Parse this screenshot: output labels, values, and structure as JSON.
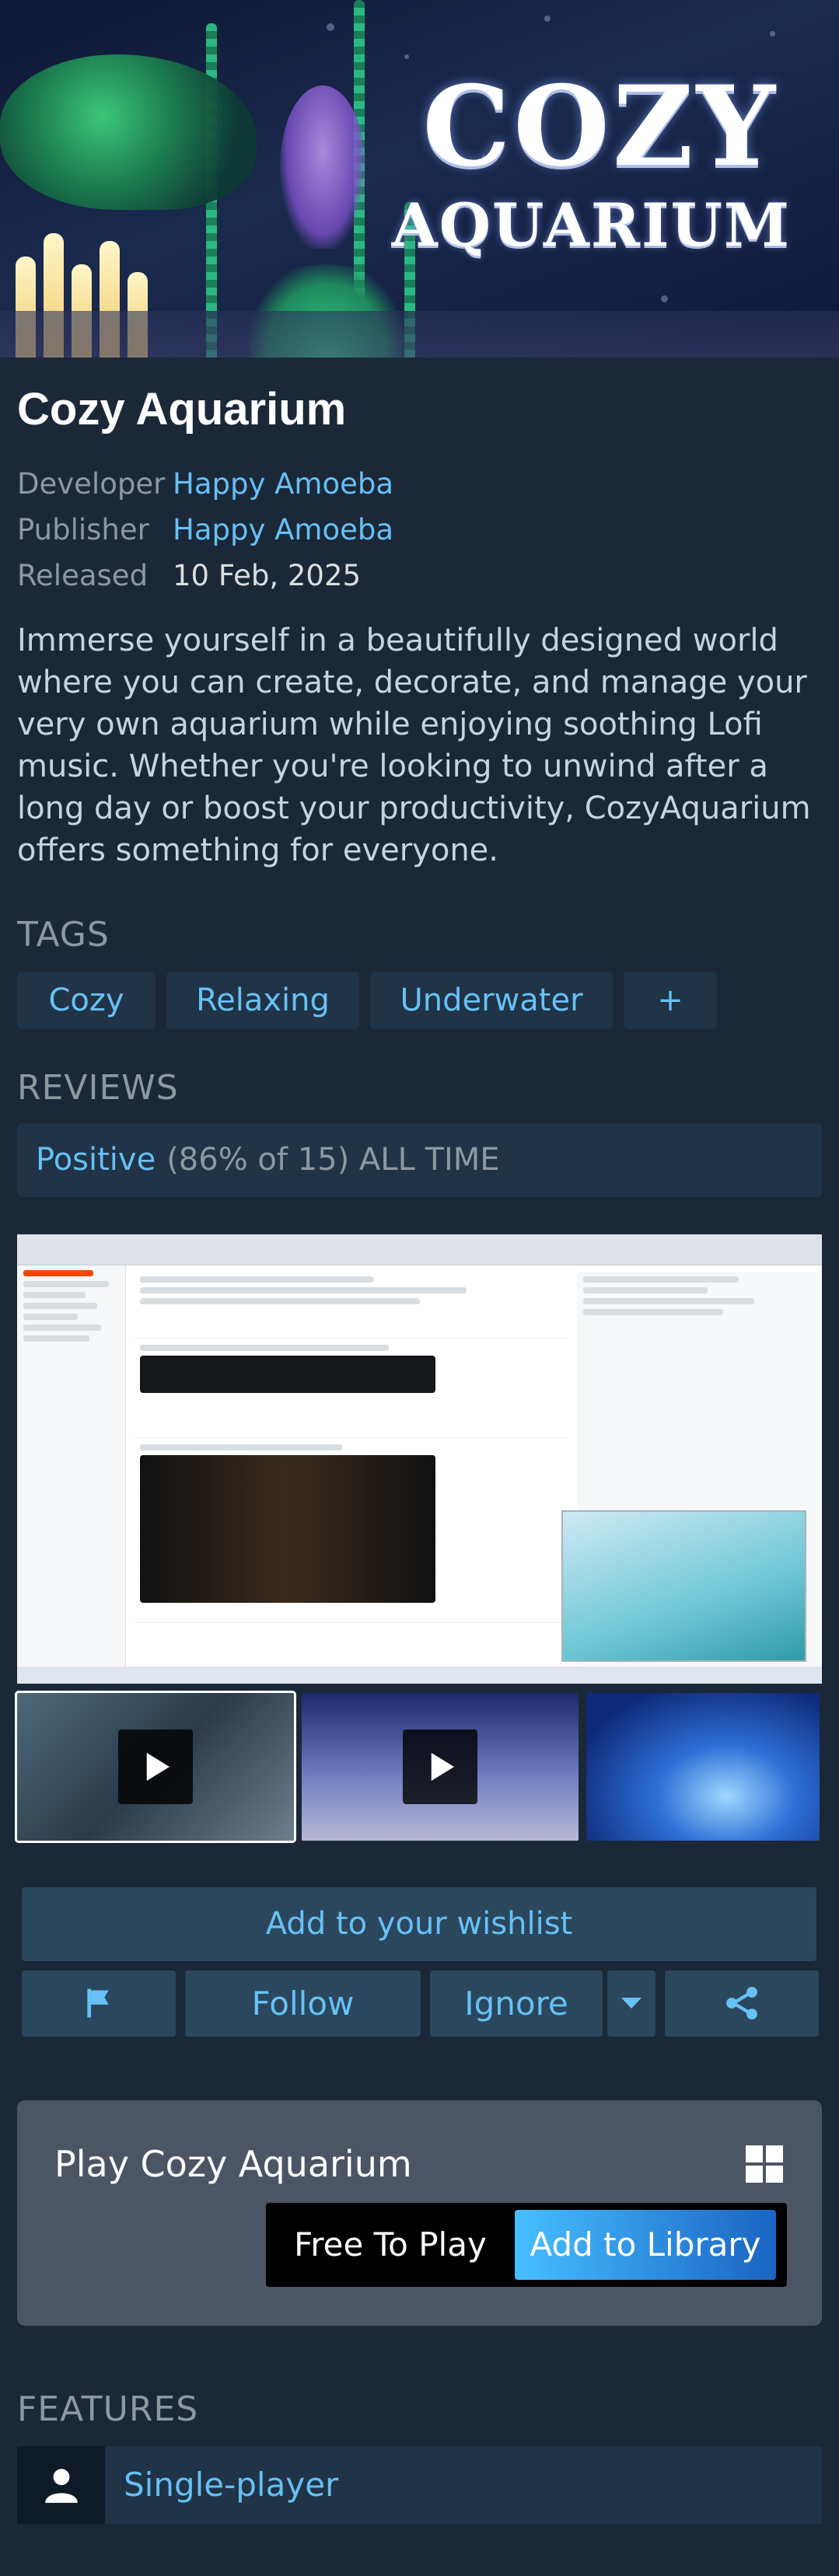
{
  "header": {
    "logo_line1": "COZY",
    "logo_line2": "AQUARIUM"
  },
  "game": {
    "title": "Cozy Aquarium",
    "developer_label": "Developer",
    "developer": "Happy Amoeba",
    "publisher_label": "Publisher",
    "publisher": "Happy Amoeba",
    "released_label": "Released",
    "released": "10 Feb, 2025",
    "description": "Immerse yourself in a beautifully designed world where you can create, decorate, and manage your very own aquarium while enjoying soothing Lofi music. Whether you're looking to unwind after a long day or boost your productivity, CozyAquarium offers something for everyone."
  },
  "tags": {
    "heading": "TAGS",
    "items": [
      "Cozy",
      "Relaxing",
      "Underwater",
      "+"
    ]
  },
  "reviews": {
    "heading": "REVIEWS",
    "rating": "Positive",
    "detail": "(86% of 15) ALL TIME"
  },
  "media": {
    "thumbnails": [
      {
        "type": "video",
        "selected": true
      },
      {
        "type": "video",
        "selected": false
      },
      {
        "type": "image",
        "selected": false
      }
    ]
  },
  "actions": {
    "wishlist": "Add to your wishlist",
    "follow": "Follow",
    "ignore": "Ignore"
  },
  "purchase": {
    "title": "Play Cozy Aquarium",
    "price": "Free To Play",
    "button": "Add to Library"
  },
  "features": {
    "heading": "FEATURES",
    "items": [
      {
        "label": "Single-player",
        "icon": "person-icon"
      }
    ]
  },
  "colors": {
    "background": "#1b2838",
    "link": "#66c0f4",
    "button_bg": "#2a475e",
    "panel": "#203347",
    "purchase_panel": "#4c5564"
  }
}
